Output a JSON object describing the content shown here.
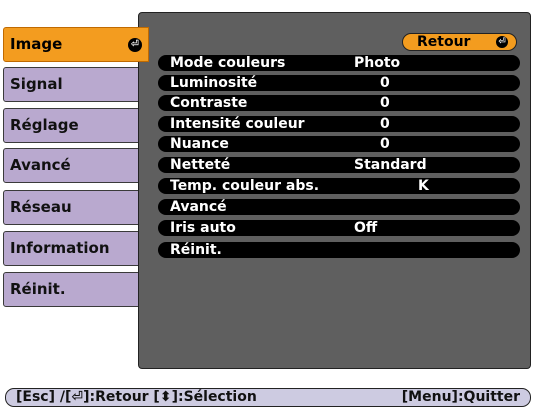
{
  "sidebar": {
    "items": [
      {
        "label": "Image",
        "active": true,
        "icon": "enter-icon"
      },
      {
        "label": "Signal"
      },
      {
        "label": "Réglage"
      },
      {
        "label": "Avancé"
      },
      {
        "label": "Réseau"
      },
      {
        "label": "Information"
      },
      {
        "label": "Réinit."
      }
    ]
  },
  "panel": {
    "retour_label": "Retour",
    "retour_icon": "enter-icon",
    "rows": [
      {
        "label": "Mode couleurs",
        "value": "Photo"
      },
      {
        "label": "Luminosité",
        "value": "0"
      },
      {
        "label": "Contraste",
        "value": "0"
      },
      {
        "label": "Intensité couleur",
        "value": "0"
      },
      {
        "label": "Nuance",
        "value": "0"
      },
      {
        "label": "Netteté",
        "value": "Standard"
      },
      {
        "label": "Temp. couleur abs.",
        "value": "K"
      },
      {
        "label": "Avancé",
        "value": ""
      },
      {
        "label": "Iris auto",
        "value": "Off"
      },
      {
        "label": "Réinit.",
        "value": ""
      }
    ]
  },
  "footer": {
    "left_hint": "[Esc] /[⏎]:Retour  [⬍]:Sélection",
    "right_hint": "[Menu]:Quitter"
  },
  "colors": {
    "active_tab": "#f39c1f",
    "inactive_tab": "#b9a9cf",
    "panel_bg": "#5f5f5f",
    "row_bg": "#000000",
    "footer_bg": "#cdcbe1"
  }
}
